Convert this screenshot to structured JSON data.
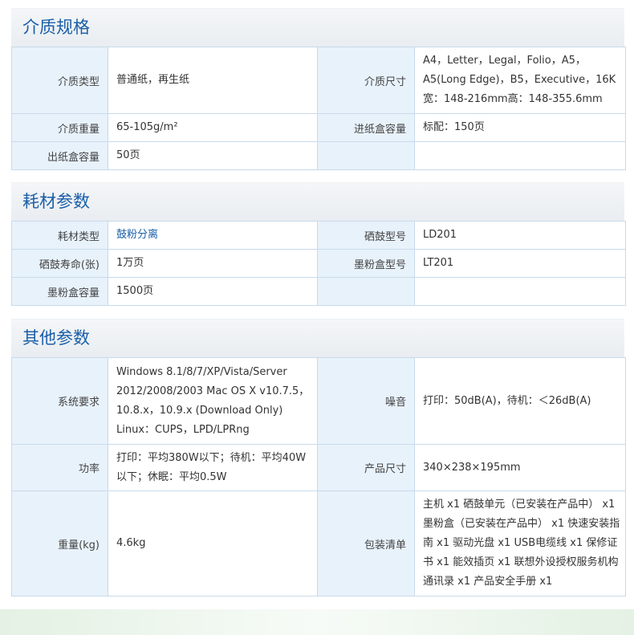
{
  "sections": [
    {
      "title": "介质规格",
      "rows": [
        {
          "l1": "介质类型",
          "v1": "普通纸，再生纸",
          "l2": "介质尺寸",
          "v2": "A4，Letter，Legal，Folio，A5，A5(Long Edge)，B5，Executive，16K宽：148-216mm高：148-355.6mm"
        },
        {
          "l1": "介质重量",
          "v1": "65-105g/m²",
          "l2": "进纸盒容量",
          "v2": "标配：150页"
        },
        {
          "l1": "出纸盒容量",
          "v1": "50页",
          "l2": "",
          "v2": ""
        }
      ]
    },
    {
      "title": "耗材参数",
      "rows": [
        {
          "l1": "耗材类型",
          "v1": "鼓粉分离",
          "l2": "硒鼓型号",
          "v2": "LD201"
        },
        {
          "l1": "硒鼓寿命(张)",
          "v1": "1万页",
          "l2": "墨粉盒型号",
          "v2": "LT201"
        },
        {
          "l1": "墨粉盒容量",
          "v1": "1500页",
          "l2": "",
          "v2": ""
        }
      ]
    },
    {
      "title": "其他参数",
      "rows": [
        {
          "l1": "系统要求",
          "v1": "Windows 8.1/8/7/XP/Vista/Server 2012/2008/2003 Mac OS X v10.7.5，10.8.x，10.9.x (Download Only) Linux：CUPS，LPD/LPRng",
          "l2": "噪音",
          "v2": "打印：50dB(A)，待机：＜26dB(A)"
        },
        {
          "l1": "功率",
          "v1": "打印：平均380W以下；待机：平均40W以下；休眠：平均0.5W",
          "l2": "产品尺寸",
          "v2": "340×238×195mm"
        },
        {
          "l1": "重量(kg)",
          "v1": "4.6kg",
          "l2": "包装清单",
          "v2": "主机 x1 硒鼓单元（已安装在产品中） x1 墨粉盒（已安装在产品中） x1 快速安装指南 x1 驱动光盘 x1 USB电缆线 x1 保修证书 x1 能效插页 x1 联想外设授权服务机构通讯录 x1 产品安全手册 x1"
        }
      ]
    }
  ]
}
